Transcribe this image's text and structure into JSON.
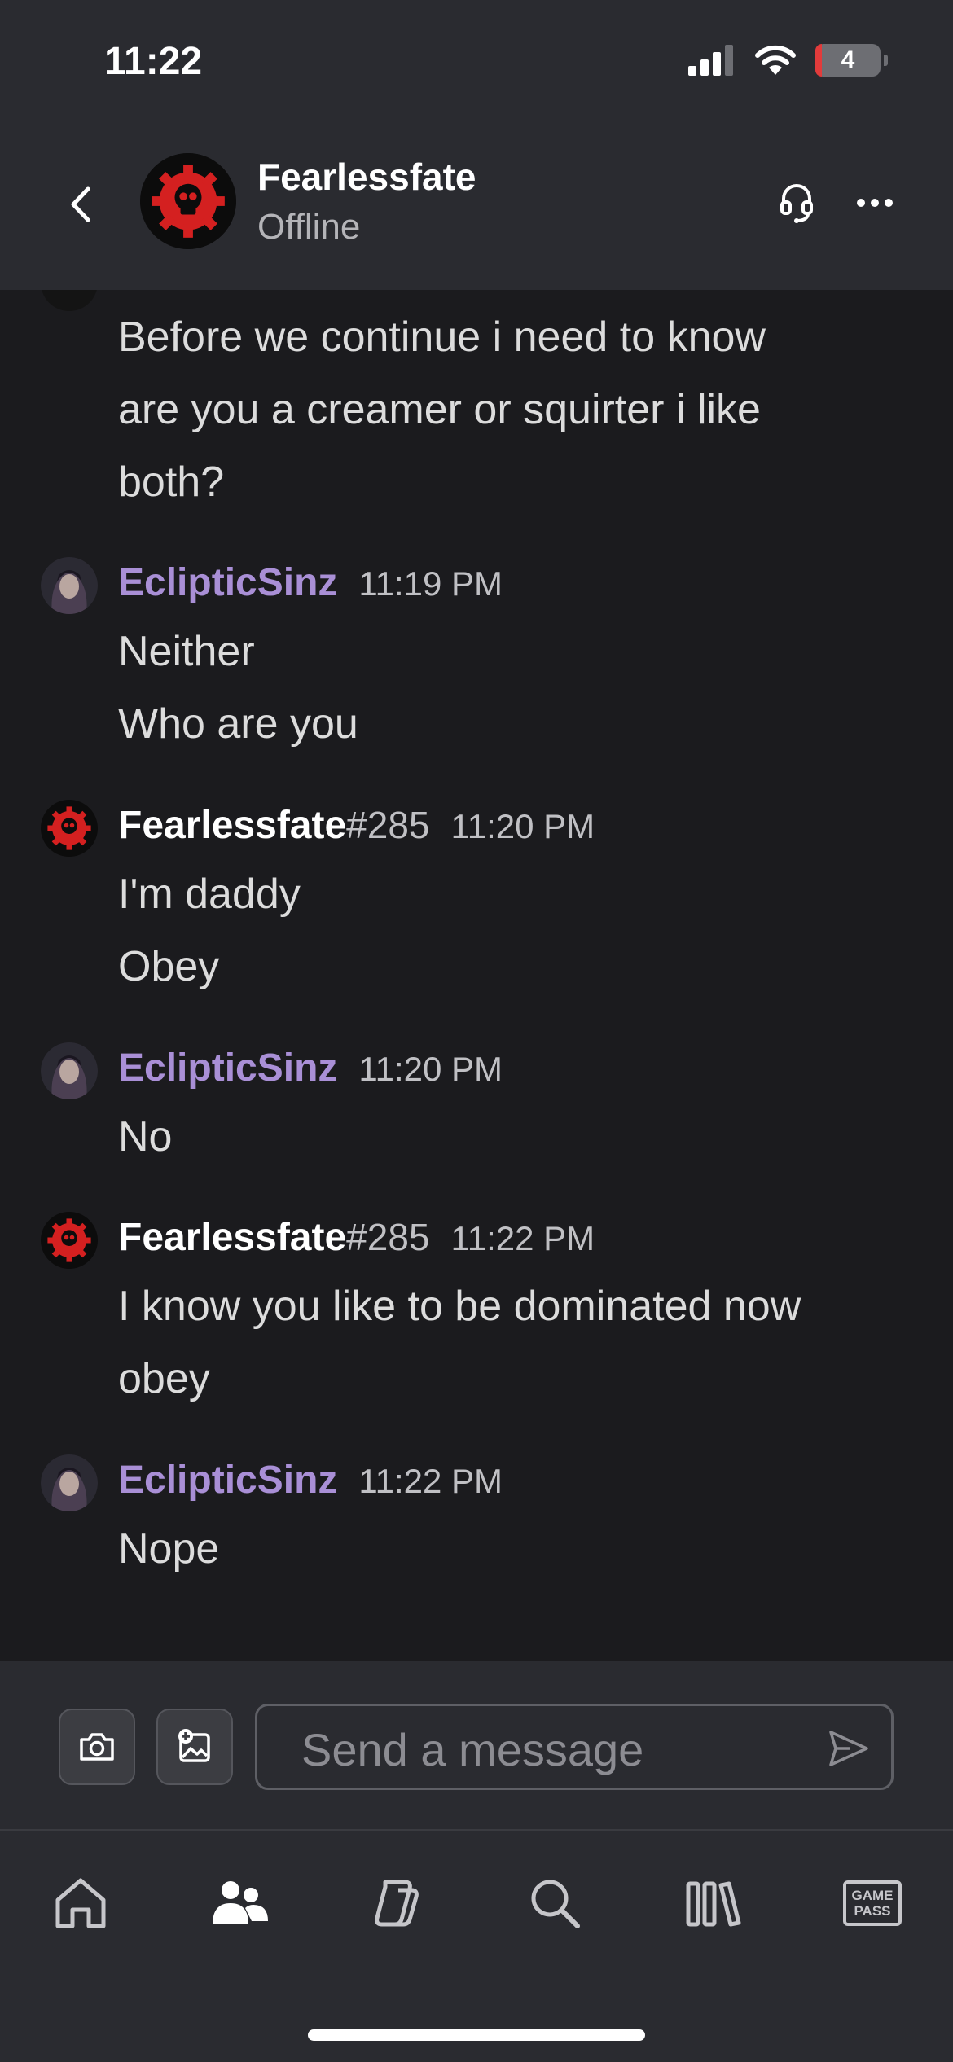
{
  "status_bar": {
    "time": "11:22",
    "battery": "4"
  },
  "header": {
    "name": "Fearlessfate",
    "status": "Offline"
  },
  "messages": [
    {
      "lines": [
        "Before we continue i need to know",
        "are you a creamer or squirter i like",
        "both?"
      ]
    },
    {
      "author": "EclipticSinz",
      "time": "11:19 PM",
      "lines": [
        "Neither",
        "Who are you"
      ]
    },
    {
      "author": "Fearlessfate",
      "tag": "#285",
      "time": "11:20 PM",
      "lines": [
        "I'm daddy",
        "Obey"
      ]
    },
    {
      "author": "EclipticSinz",
      "time": "11:20 PM",
      "lines": [
        "No"
      ]
    },
    {
      "author": "Fearlessfate",
      "tag": "#285",
      "time": "11:22 PM",
      "lines": [
        "I know you like to be dominated now",
        "obey"
      ]
    },
    {
      "author": "EclipticSinz",
      "time": "11:22 PM",
      "lines": [
        "Nope"
      ]
    }
  ],
  "composer": {
    "placeholder": "Send a message"
  },
  "tabbar": {
    "gamepass_line1": "GAME",
    "gamepass_line2": "PASS"
  },
  "colors": {
    "background": "#1b1b1e",
    "panel": "#2a2b30",
    "purple_name": "#a98fd6",
    "xbox_red": "#d42020"
  },
  "icons": {
    "status": [
      "signal-icon",
      "wifi-icon",
      "battery-icon"
    ],
    "header": [
      "back-chevron-icon",
      "headset-icon",
      "more-icon"
    ],
    "composer": [
      "camera-icon",
      "add-image-icon",
      "send-icon"
    ],
    "tabs": [
      "home-icon",
      "people-icon",
      "copilot-icon",
      "search-icon",
      "library-icon",
      "gamepass-icon"
    ]
  }
}
